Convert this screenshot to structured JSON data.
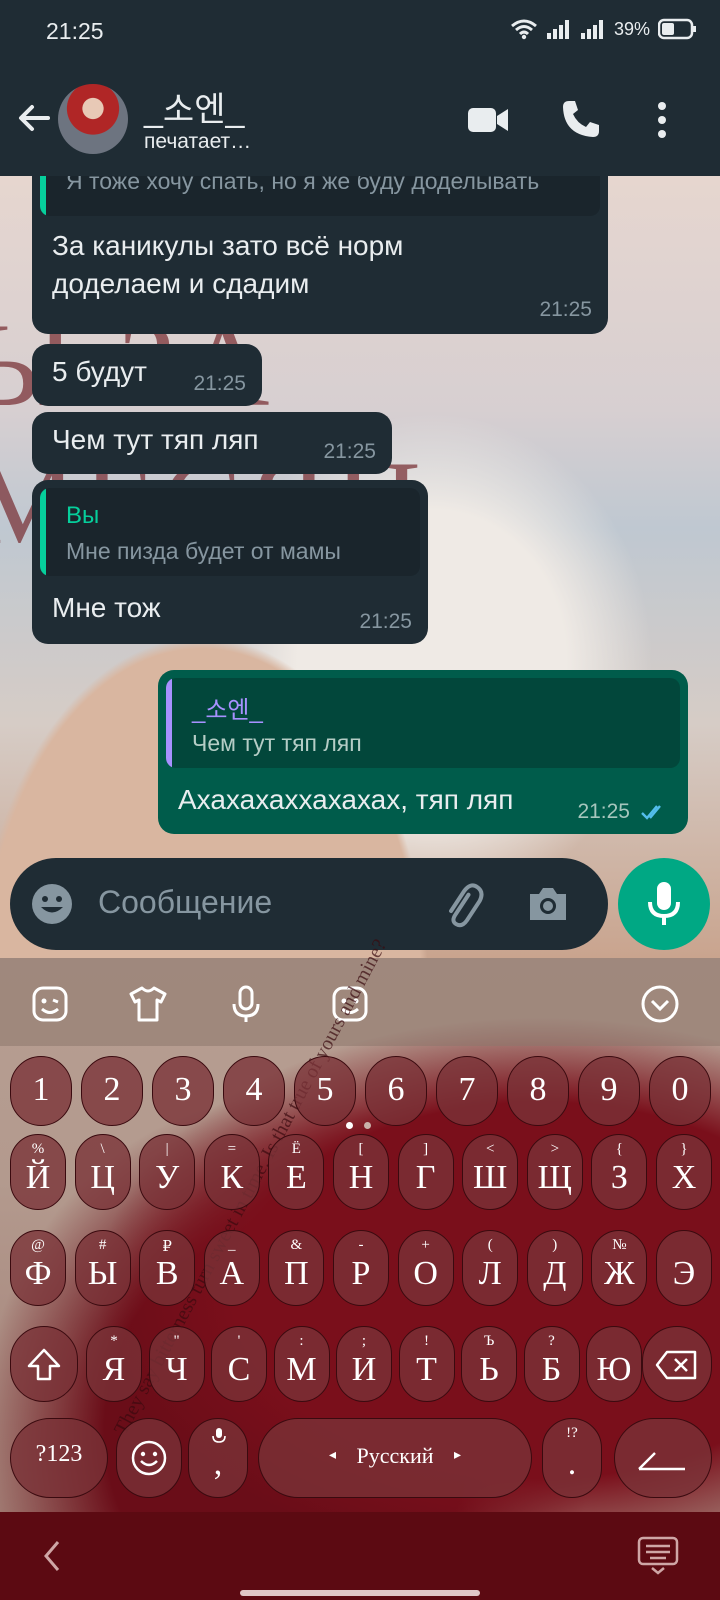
{
  "status_bar": {
    "time": "21:25",
    "battery": "39%"
  },
  "header": {
    "contact_name": "_소엔_",
    "contact_status": "печатает…"
  },
  "messages": [
    {
      "quote_text": "Я тоже хочу спать, но я же буду доделывать",
      "text_line1": "За каникулы зато всё норм",
      "text_line2": "доделаем и сдадим",
      "time": "21:25"
    },
    {
      "text": "5 будут",
      "time": "21:25"
    },
    {
      "text": "Чем тут тяп ляп",
      "time": "21:25"
    },
    {
      "quote_author": "Вы",
      "quote_text": "Мне пизда будет от мамы",
      "text": "Мне тож",
      "time": "21:25"
    },
    {
      "quote_author": "_소엔_",
      "quote_text": "Чем тут тяп ляп",
      "text": "Ахахахаххахахах, тяп ляп",
      "time": "21:25",
      "read_icon": "double-check-icon"
    }
  ],
  "composer": {
    "placeholder": "Сообщение"
  },
  "keyboard": {
    "number_row": [
      "1",
      "2",
      "3",
      "4",
      "5",
      "6",
      "7",
      "8",
      "9",
      "0"
    ],
    "row1": {
      "keys": [
        "Й",
        "Ц",
        "У",
        "К",
        "Е",
        "Н",
        "Г",
        "Ш",
        "Щ",
        "З",
        "Х"
      ],
      "hints": [
        "%",
        "\\",
        "|",
        "=",
        "Ё",
        "[",
        "]",
        "<",
        ">",
        "{",
        "}"
      ]
    },
    "row2": {
      "keys": [
        "Ф",
        "Ы",
        "В",
        "А",
        "П",
        "Р",
        "О",
        "Л",
        "Д",
        "Ж",
        "Э"
      ],
      "hints": [
        "@",
        "#",
        "₽",
        "_",
        "&",
        "-",
        "+",
        "(",
        ")",
        "№",
        ""
      ]
    },
    "row3": {
      "keys": [
        "Я",
        "Ч",
        "С",
        "М",
        "И",
        "Т",
        "Ь",
        "Б",
        "Ю"
      ],
      "hints": [
        "*",
        "\"",
        "'",
        ":",
        ";",
        "!",
        "Ъ",
        "?",
        ""
      ]
    },
    "symbols_label": "?123",
    "comma_label": ",",
    "space_label": "Русский",
    "period_label": ".",
    "period_hint": "!?",
    "background_text": "They say bitterness turn sweet in time. Is that true of yours and mine?"
  },
  "colors": {
    "accent": "#00a884",
    "bubble_in": "#1f2c34",
    "bubble_out": "#005c4b",
    "quote_self": "#06cf9c",
    "quote_other": "#a791ff"
  }
}
